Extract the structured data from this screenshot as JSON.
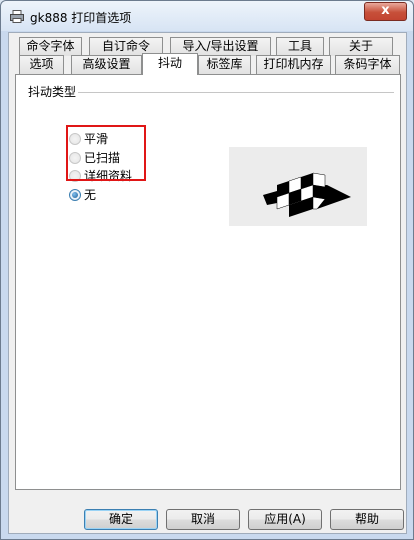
{
  "window": {
    "title": "gk888 打印首选项",
    "close_glyph": "x"
  },
  "tabs": {
    "back_row": [
      "命令字体",
      "自订命令",
      "导入/导出设置",
      "工具",
      "关于"
    ],
    "front_row": [
      "选项",
      "高级设置",
      "抖动",
      "标签库",
      "打印机内存",
      "条码字体"
    ],
    "active": "抖动"
  },
  "dithering": {
    "group_label": "抖动类型",
    "options": [
      {
        "label": "平滑",
        "selected": false,
        "enabled": false
      },
      {
        "label": "已扫描",
        "selected": false,
        "enabled": false
      },
      {
        "label": "详细资料",
        "selected": false,
        "enabled": false
      },
      {
        "label": "无",
        "selected": true,
        "enabled": true
      }
    ],
    "highlight_color": "#e01616"
  },
  "buttons": {
    "ok": "确定",
    "cancel": "取消",
    "apply": "应用(A)",
    "help": "帮助"
  },
  "icons": {
    "title": "printer-icon",
    "preview": "dither-preview-image"
  }
}
